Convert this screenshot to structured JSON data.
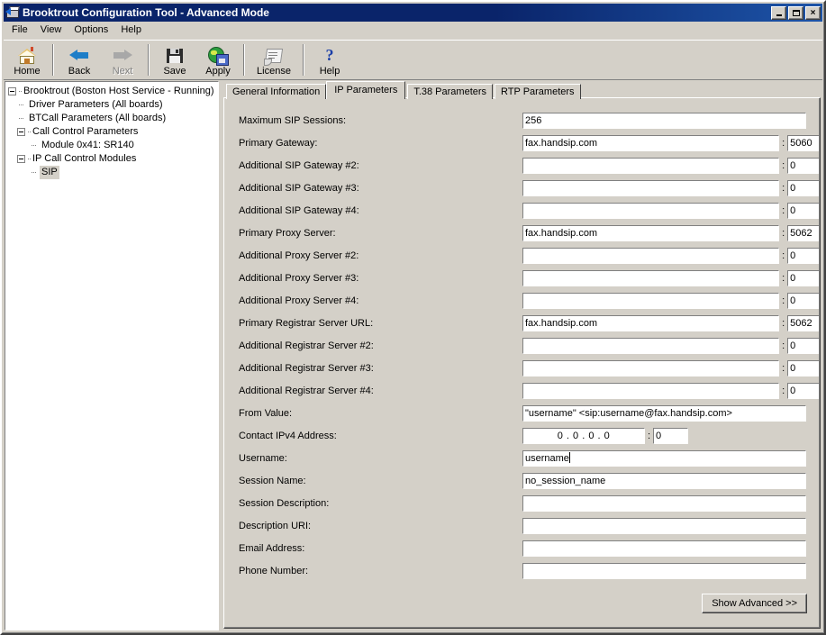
{
  "window": {
    "title": "Brooktrout Configuration Tool - Advanced Mode",
    "icon": "fax-app-icon",
    "minimize_label": "",
    "maximize_label": "",
    "close_label": "×"
  },
  "menubar": {
    "items": [
      {
        "label": "File"
      },
      {
        "label": "View"
      },
      {
        "label": "Options"
      },
      {
        "label": "Help"
      }
    ]
  },
  "toolbar": {
    "buttons": [
      {
        "label": "Home",
        "icon": "home-icon",
        "enabled": true
      },
      {
        "label": "Back",
        "icon": "back-arrow-icon",
        "enabled": true
      },
      {
        "label": "Next",
        "icon": "next-arrow-icon",
        "enabled": false
      },
      {
        "label": "Save",
        "icon": "floppy-disk-icon",
        "enabled": true
      },
      {
        "label": "Apply",
        "icon": "globe-disk-icon",
        "enabled": true
      },
      {
        "label": "License",
        "icon": "certificate-icon",
        "enabled": true
      },
      {
        "label": "Help",
        "icon": "question-mark-icon",
        "enabled": true
      }
    ]
  },
  "tree": {
    "root": "Brooktrout (Boston Host Service - Running)",
    "nodes": [
      {
        "label": "Driver Parameters (All boards)",
        "level": 1,
        "expander": "none"
      },
      {
        "label": "BTCall Parameters (All boards)",
        "level": 1,
        "expander": "none"
      },
      {
        "label": "Call Control Parameters",
        "level": 1,
        "expander": "minus"
      },
      {
        "label": "Module 0x41: SR140",
        "level": 2,
        "expander": "none"
      },
      {
        "label": "IP Call Control Modules",
        "level": 1,
        "expander": "minus"
      },
      {
        "label": "SIP",
        "level": 2,
        "expander": "none",
        "selected": true
      }
    ]
  },
  "tabs": [
    {
      "label": "General Information",
      "active": false
    },
    {
      "label": "IP Parameters",
      "active": true
    },
    {
      "label": "T.38 Parameters",
      "active": false
    },
    {
      "label": "RTP Parameters",
      "active": false
    }
  ],
  "form": {
    "rows": [
      {
        "label": "Maximum SIP Sessions:",
        "type": "single",
        "value": "256"
      },
      {
        "label": "Primary Gateway:",
        "type": "host_port",
        "value": "fax.handsip.com",
        "port": "5060"
      },
      {
        "label": "Additional SIP Gateway #2:",
        "type": "host_port",
        "value": "",
        "port": "0"
      },
      {
        "label": "Additional SIP Gateway #3:",
        "type": "host_port",
        "value": "",
        "port": "0"
      },
      {
        "label": "Additional SIP Gateway #4:",
        "type": "host_port",
        "value": "",
        "port": "0"
      },
      {
        "label": "Primary Proxy Server:",
        "type": "host_port",
        "value": "fax.handsip.com",
        "port": "5062"
      },
      {
        "label": "Additional Proxy Server #2:",
        "type": "host_port",
        "value": "",
        "port": "0"
      },
      {
        "label": "Additional Proxy Server #3:",
        "type": "host_port",
        "value": "",
        "port": "0"
      },
      {
        "label": "Additional Proxy Server #4:",
        "type": "host_port",
        "value": "",
        "port": "0"
      },
      {
        "label": "Primary Registrar Server URL:",
        "type": "host_port",
        "value": "fax.handsip.com",
        "port": "5062"
      },
      {
        "label": "Additional Registrar Server #2:",
        "type": "host_port",
        "value": "",
        "port": "0"
      },
      {
        "label": "Additional Registrar Server #3:",
        "type": "host_port",
        "value": "",
        "port": "0"
      },
      {
        "label": "Additional Registrar Server #4:",
        "type": "host_port",
        "value": "",
        "port": "0"
      },
      {
        "label": "From Value:",
        "type": "single",
        "value": "\"username\" <sip:username@fax.handsip.com>"
      },
      {
        "label": "Contact IPv4 Address:",
        "type": "ip_port",
        "value": "0 . 0 . 0 . 0",
        "port": "0"
      },
      {
        "label": "Username:",
        "type": "single",
        "value": "username",
        "focused": true
      },
      {
        "label": "Session Name:",
        "type": "single",
        "value": "no_session_name"
      },
      {
        "label": "Session Description:",
        "type": "single",
        "value": ""
      },
      {
        "label": "Description URI:",
        "type": "single",
        "value": ""
      },
      {
        "label": "Email Address:",
        "type": "single",
        "value": ""
      },
      {
        "label": "Phone Number:",
        "type": "single",
        "value": ""
      }
    ],
    "show_advanced_button": "Show Advanced >>"
  },
  "colors": {
    "window_face": "#d4d0c8",
    "title_active": "#0a246a",
    "field_bg": "#ffffff",
    "text": "#000000",
    "disabled_text": "#808080"
  }
}
